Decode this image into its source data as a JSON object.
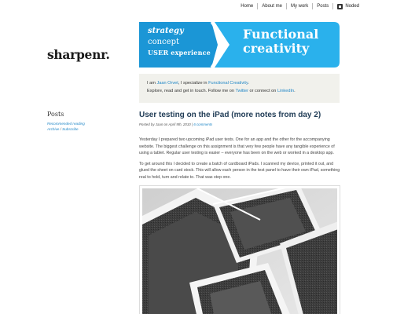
{
  "nav": {
    "items": [
      "Home",
      "About me",
      "My work",
      "Posts"
    ],
    "noded": "Noded"
  },
  "site": {
    "logo": "sharpenr."
  },
  "banner": {
    "left": [
      "strategy",
      "concept",
      "USER experience"
    ],
    "right": [
      "Functional",
      "creativity"
    ],
    "colors": {
      "dark": "#1b96d6",
      "light": "#2ab1ec"
    }
  },
  "intro": {
    "p1": "I am ",
    "name": "Jaan Orvet",
    "p2": ", I specialize in ",
    "specialty": "Functional Creativity",
    "p3": ".",
    "p4": "Explore, read and get in touch. Follow me on ",
    "twitter": "Twitter",
    "p5": " or connect on ",
    "linkedin": "LinkedIn",
    "p6": "."
  },
  "sidebar": {
    "heading": "Posts",
    "recommended": "Recommended reading",
    "archive": "Archive",
    "sep": " / ",
    "subscribe": "Subscribe"
  },
  "post": {
    "title": "User testing on the iPad (more notes from day 2)",
    "meta_prefix": "Posted by Jaan on April 9th, 2010 | ",
    "comments": "6 comments",
    "paragraphs": [
      "Yesterday I prepared two upcoming iPad user tests. One for an app and the other for the accompanying website. The biggest challenge on this assignment is that very few people have any tangible experience of using a tablet. Regular user testing is easier – everyone has been on the web or worked in a desktop app.",
      "To get around this I decided to create a batch of cardboard iPads. I scanned my device, printed it out, and glued the sheet on card stock. This will allow each person in the test panel to have their own iPad, something real to hold, turn and relate to. That was step one."
    ]
  }
}
